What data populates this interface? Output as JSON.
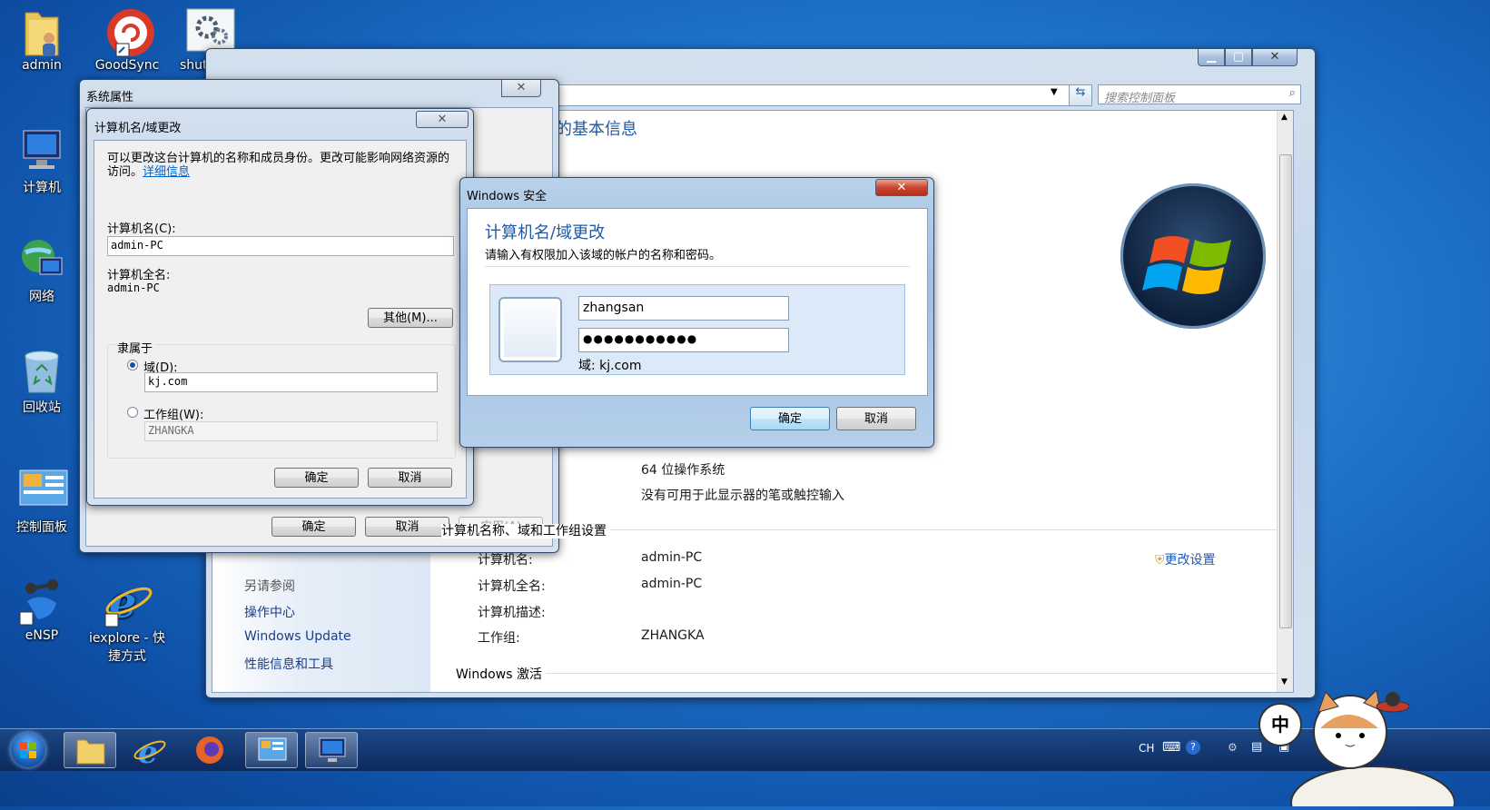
{
  "desktop": {
    "icons": [
      {
        "label": "admin",
        "icon": "folder-user-icon"
      },
      {
        "label": "GoodSync",
        "icon": "goodsync-icon"
      },
      {
        "label": "shutdown",
        "icon": "gear-icon"
      },
      {
        "label": "计算机",
        "icon": "computer-icon"
      },
      {
        "label": "网络",
        "icon": "network-icon"
      },
      {
        "label": "回收站",
        "icon": "recycle-bin-icon"
      },
      {
        "label": "控制面板",
        "icon": "control-panel-icon"
      },
      {
        "label": "eNSP",
        "icon": "ensp-icon"
      },
      {
        "label": "iexplore - 快捷方式",
        "icon": "internet-explorer-icon"
      }
    ]
  },
  "control_panel": {
    "search_placeholder": "搜索控制面板",
    "heading": "查看有关计算机的基本信息",
    "system_type_value": "64 位操作系统",
    "pen_touch_value": "没有可用于此显示器的笔或触控输入",
    "section_computer_name": "计算机名称、域和工作组设置",
    "rows": [
      {
        "label": "计算机名:",
        "value": "admin-PC"
      },
      {
        "label": "计算机全名:",
        "value": "admin-PC"
      },
      {
        "label": "计算机描述:",
        "value": ""
      },
      {
        "label": "工作组:",
        "value": "ZHANGKA"
      }
    ],
    "change_settings": "更改设置",
    "see_also": "另请参阅",
    "nav_links": [
      "操作中心",
      "Windows Update",
      "性能信息和工具"
    ],
    "section_activation": "Windows 激活"
  },
  "system_properties": {
    "title": "系统属性",
    "ok": "确定",
    "cancel": "取消",
    "apply": "应用(A)"
  },
  "name_change": {
    "title": "计算机名/域更改",
    "description": "可以更改这台计算机的名称和成员身份。更改可能影响网络资源的访问。",
    "details_link": "详细信息",
    "computer_name_label": "计算机名(C):",
    "computer_name_value": "admin-PC",
    "full_name_label": "计算机全名:",
    "full_name_value": "admin-PC",
    "more_button": "其他(M)...",
    "member_of_label": "隶属于",
    "domain_label": "域(D):",
    "domain_value": "kj.com",
    "workgroup_label": "工作组(W):",
    "workgroup_value": "ZHANGKA",
    "ok": "确定",
    "cancel": "取消"
  },
  "security": {
    "title": "Windows 安全",
    "heading": "计算机名/域更改",
    "subtitle": "请输入有权限加入该域的帐户的名称和密码。",
    "username": "zhangsan",
    "password": "●●●●●●●●●●●",
    "domain_text": "域: kj.com",
    "ok": "确定",
    "cancel": "取消"
  },
  "taskbar": {
    "tray_lang": "CH",
    "ime": "中"
  },
  "colors": {
    "desktop": "#1d6fc7",
    "title_blue": "#1e5aa8",
    "link": "#0066cc"
  }
}
